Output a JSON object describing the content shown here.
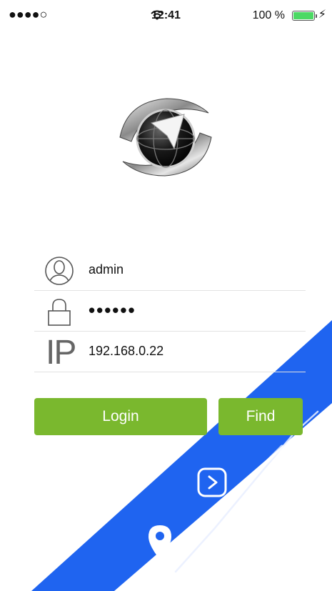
{
  "status_bar": {
    "signal": "●●●●○",
    "time": "12:41",
    "battery_text": "100 %",
    "battery_level": 1.0
  },
  "login_form": {
    "username": "admin",
    "password_mask": "••••••",
    "ip_label": "IP",
    "ip_address": "192.168.0.22"
  },
  "buttons": {
    "login_label": "Login",
    "find_label": "Find"
  },
  "icons": {
    "user": "user-icon",
    "lock": "lock-icon",
    "ip": "ip-icon",
    "play": "play-icon",
    "location": "location-pin-icon"
  },
  "colors": {
    "accent_green": "#7ab82e",
    "stripe_blue": "#1f64f0",
    "battery_green": "#4cd964"
  }
}
